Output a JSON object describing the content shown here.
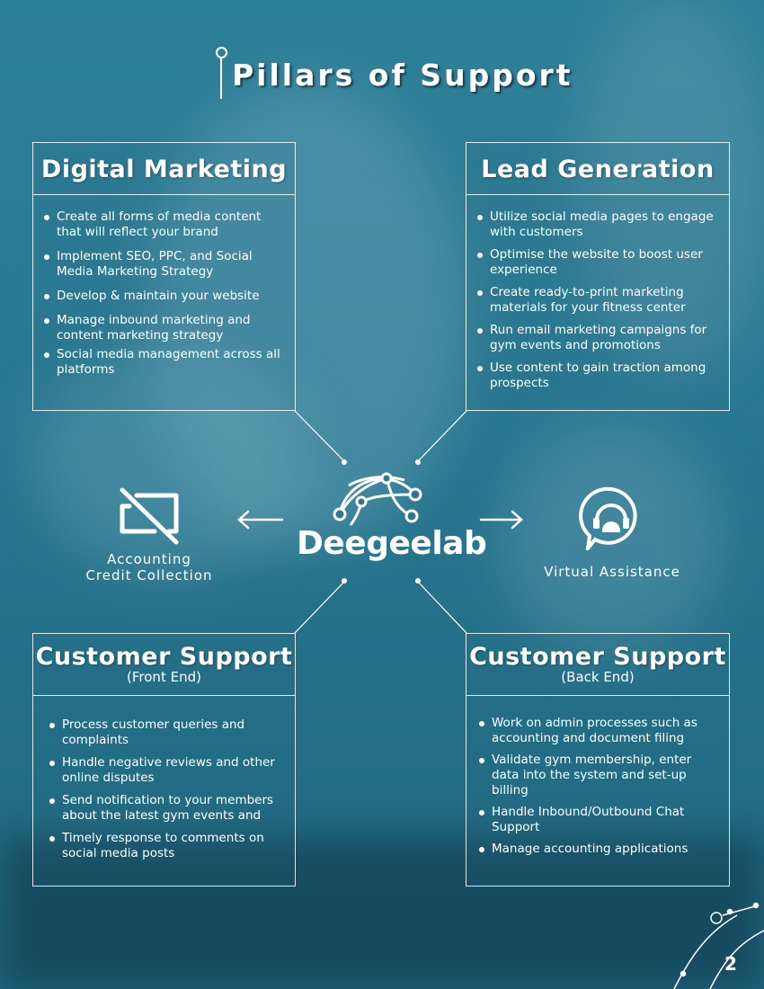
{
  "title": "Pillars of Support",
  "center": {
    "logo_text": "Deegeelab"
  },
  "left_service": {
    "line1": "Accounting",
    "line2": "Credit Collection",
    "icon": "card-crossed-icon"
  },
  "right_service": {
    "label": "Virtual Assistance",
    "icon": "headset-chat-icon"
  },
  "digital_marketing": {
    "title": "Digital Marketing",
    "items": [
      "Create all forms of media content that will reflect your brand",
      "Implement SEO, PPC, and Social Media Marketing Strategy",
      "Develop & maintain your website",
      "Manage inbound marketing and content marketing strategy",
      "Social media management across all platforms"
    ]
  },
  "lead_generation": {
    "title": "Lead Generation",
    "items": [
      "Utilize social media pages to engage with customers",
      "Optimise the website to boost user experience",
      "Create ready-to-print marketing materials for your fitness center",
      "Run email marketing campaigns for gym events and promotions",
      "Use content to gain traction among prospects"
    ]
  },
  "customer_support_front": {
    "title": "Customer Support",
    "subtitle": "(Front End)",
    "items": [
      "Process customer queries and complaints",
      "Handle negative reviews and other online disputes",
      "Send notification to your members about the latest gym events and",
      "Timely response to comments on social media posts"
    ]
  },
  "customer_support_back": {
    "title": "Customer Support",
    "subtitle": "(Back End)",
    "items": [
      "Work on admin processes such as accounting and document filing",
      "Validate gym membership, enter data into the system and set-up billing",
      "Handle Inbound/Outbound Chat Support",
      "Manage accounting applications"
    ]
  },
  "page_number": "2",
  "colors": {
    "background": "#2a7892",
    "text": "#ffffff"
  }
}
